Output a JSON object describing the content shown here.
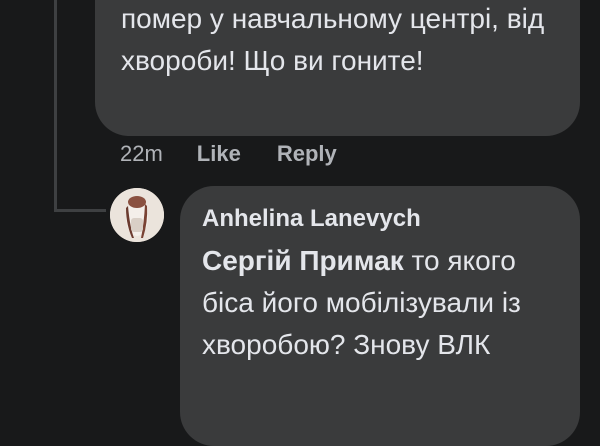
{
  "previous_comment": {
    "text": "помер у навчальному центрі, від хвороби! Що ви гоните!"
  },
  "actions": {
    "time": "22m",
    "like_label": "Like",
    "reply_label": "Reply"
  },
  "reply": {
    "author": "Anhelina Lanevych",
    "mention": "Сергій Примак",
    "text": " то якого біса його мобілізували із хворобою? Знову ВЛК"
  },
  "colors": {
    "background": "#18191a",
    "bubble": "#3a3b3c",
    "text_primary": "#e4e6eb",
    "text_secondary": "#b0b3b8",
    "thread_line": "#3e4042"
  }
}
